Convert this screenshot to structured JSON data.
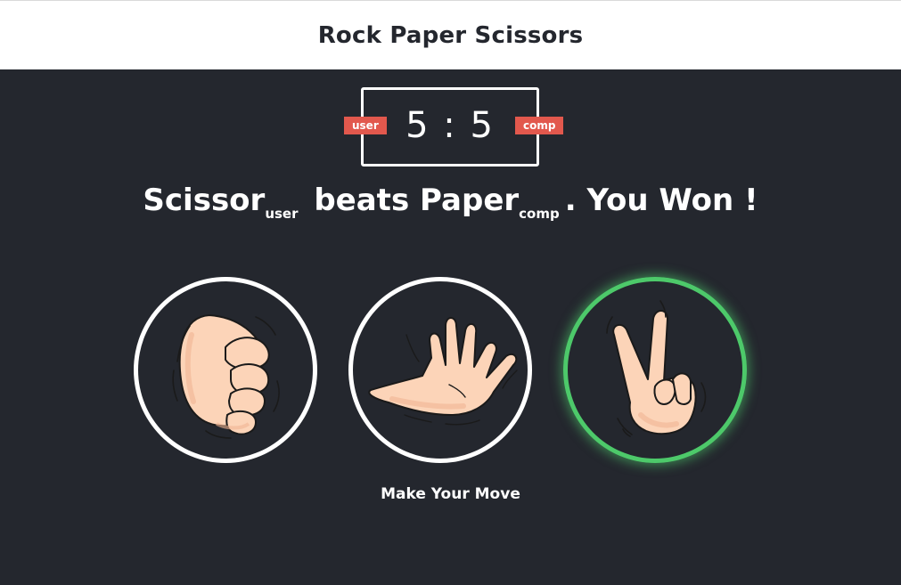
{
  "header": {
    "title": "Rock Paper Scissors"
  },
  "scoreboard": {
    "user_score": "5",
    "separator": ":",
    "comp_score": "5",
    "user_label": "user",
    "comp_label": "comp"
  },
  "result": {
    "user_choice": "Scissor",
    "user_tag": "user",
    "verb": "beats",
    "comp_choice": "Paper",
    "comp_tag": "comp",
    "outcome": ". You Won !"
  },
  "choices": [
    {
      "name": "rock",
      "icon": "rock-hand-icon",
      "selected": false
    },
    {
      "name": "paper",
      "icon": "paper-hand-icon",
      "selected": false
    },
    {
      "name": "scissors",
      "icon": "scissors-hand-icon",
      "selected": true
    }
  ],
  "prompt": "Make Your Move",
  "colors": {
    "background": "#24272e",
    "header": "#ffffff",
    "badge": "#e2584d",
    "win_ring": "#4dc96a",
    "skin": "#fcd4b8",
    "outline": "#1a1a1a"
  }
}
